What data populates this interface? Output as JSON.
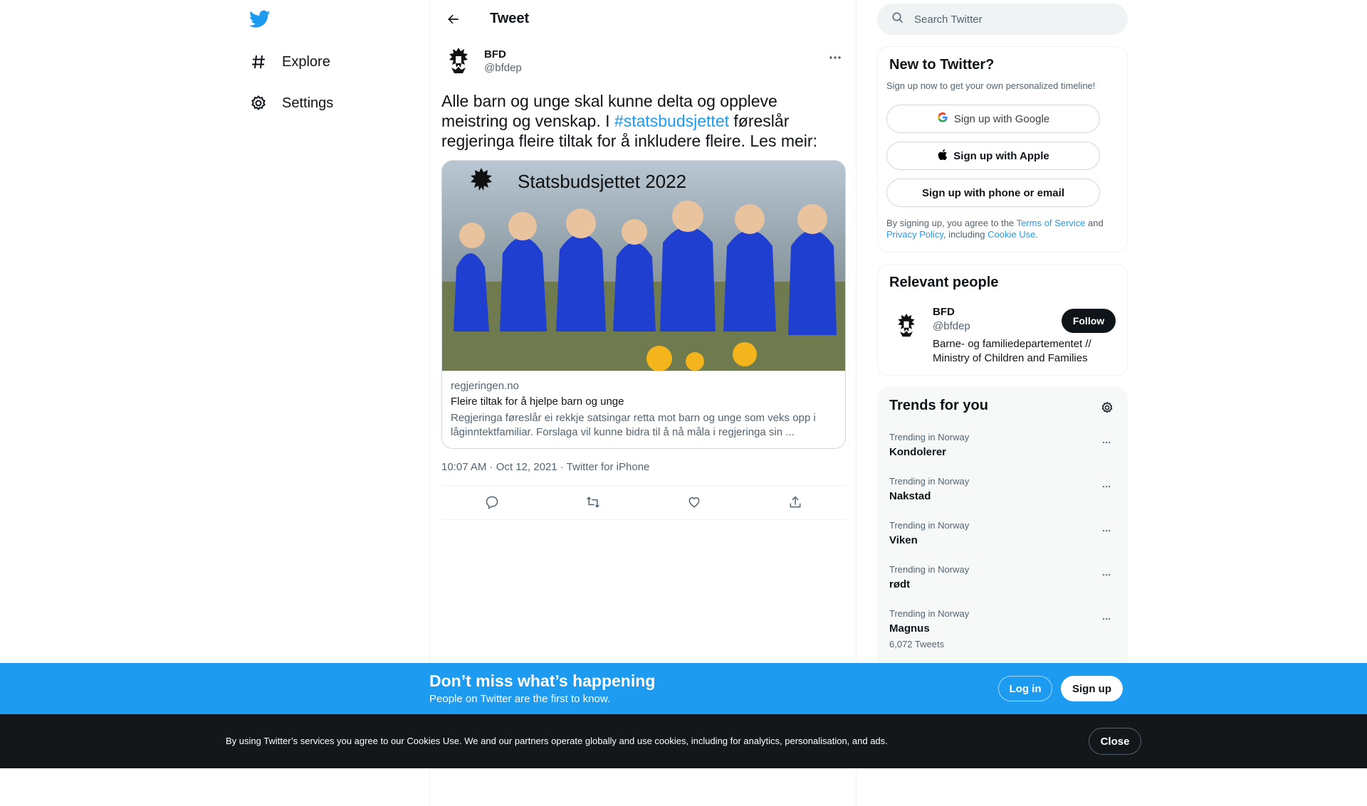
{
  "nav": {
    "items": [
      {
        "label": "Explore",
        "icon": "hash-icon"
      },
      {
        "label": "Settings",
        "icon": "gear-icon"
      }
    ]
  },
  "header": {
    "title": "Tweet"
  },
  "tweet": {
    "author_name": "BFD",
    "author_handle": "@bfdep",
    "text_before": "Alle barn og unge skal kunne delta og oppleve meistring og venskap. I ",
    "hashtag": "#statsbudsjettet",
    "text_after": " føreslår regjeringa  fleire tiltak for å inkludere fleire. Les meir:",
    "card": {
      "image_caption": "Statsbudsjettet 2022",
      "domain": "regjeringen.no",
      "title": "Fleire tiltak for å hjelpe barn og unge",
      "description": "Regjeringa føreslår ei rekkje satsingar retta mot barn og unge som veks opp i låginntektfamiliar. Forslaga vil kunne bidra til å nå måla i regjeringa sin ..."
    },
    "meta": "10:07 AM · Oct 12, 2021 · Twitter for iPhone"
  },
  "search": {
    "placeholder": "Search Twitter"
  },
  "new_to_twitter": {
    "title": "New to Twitter?",
    "subtitle": "Sign up now to get your own personalized timeline!",
    "google": "Sign up with Google",
    "apple": "Sign up with Apple",
    "phone": "Sign up with phone or email",
    "legal_1": "By signing up, you agree to the ",
    "tos": "Terms of Service",
    "legal_2": " and ",
    "privacy": "Privacy Policy",
    "legal_3": ", including ",
    "cookie": "Cookie Use."
  },
  "relevant": {
    "title": "Relevant people",
    "name": "BFD",
    "handle": "@bfdep",
    "bio": "Barne- og familiedepartementet // Ministry of Children and Families",
    "follow": "Follow"
  },
  "trends": {
    "title": "Trends for you",
    "items": [
      {
        "context": "Trending in Norway",
        "title": "Kondolerer",
        "count": ""
      },
      {
        "context": "Trending in Norway",
        "title": "Nakstad",
        "count": ""
      },
      {
        "context": "Trending in Norway",
        "title": "Viken",
        "count": ""
      },
      {
        "context": "Trending in Norway",
        "title": "rødt",
        "count": ""
      },
      {
        "context": "Trending in Norway",
        "title": "Magnus",
        "count": "6,072 Tweets"
      }
    ]
  },
  "banner": {
    "title": "Don’t miss what’s happening",
    "subtitle": "People on Twitter are the first to know.",
    "login": "Log in",
    "signup": "Sign up"
  },
  "cookies": {
    "text": "By using Twitter’s services you agree to our Cookies Use. We and our partners operate globally and use cookies, including for analytics, personalisation, and ads.",
    "close": "Close"
  },
  "colors": {
    "accent": "#1d9bf0",
    "dark": "#0f1419",
    "muted": "#536471"
  }
}
